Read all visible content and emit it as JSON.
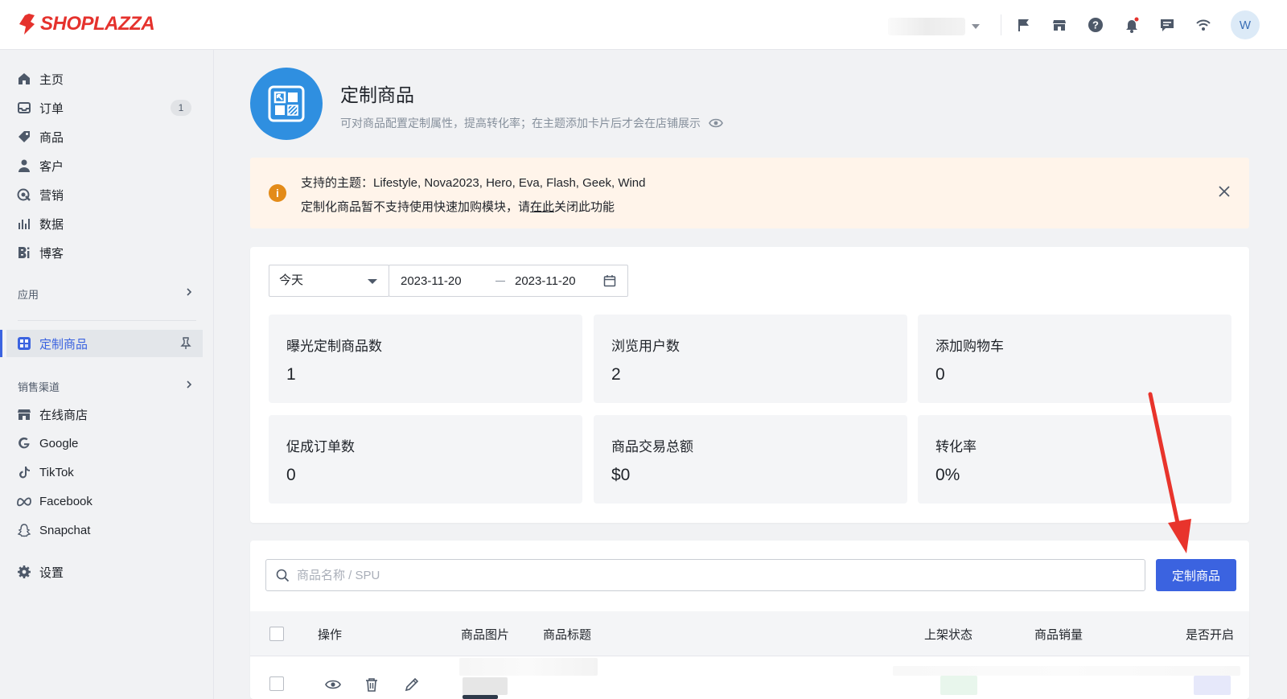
{
  "brand": {
    "name": "SHOPLAZZA",
    "color": "#e5322d"
  },
  "topbar": {
    "icons": [
      "flag-icon",
      "store-icon",
      "help-icon",
      "bell-icon",
      "message-icon",
      "wifi-icon"
    ],
    "avatar_initial": "W"
  },
  "sidebar": {
    "items": [
      {
        "label": "主页",
        "icon": "home-icon"
      },
      {
        "label": "订单",
        "icon": "inbox-icon",
        "badge": "1"
      },
      {
        "label": "商品",
        "icon": "tag-icon"
      },
      {
        "label": "客户",
        "icon": "person-icon"
      },
      {
        "label": "营销",
        "icon": "marketing-icon"
      },
      {
        "label": "数据",
        "icon": "bar-chart-icon"
      },
      {
        "label": "博客",
        "icon": "blog-icon"
      }
    ],
    "apps_label": "应用",
    "active_app": "定制商品",
    "channels_label": "销售渠道",
    "channels": [
      {
        "label": "在线商店",
        "icon": "store-icon"
      },
      {
        "label": "Google",
        "icon": "google-icon"
      },
      {
        "label": "TikTok",
        "icon": "tiktok-icon"
      },
      {
        "label": "Facebook",
        "icon": "meta-icon"
      },
      {
        "label": "Snapchat",
        "icon": "snapchat-icon"
      }
    ],
    "settings_label": "设置"
  },
  "header": {
    "title": "定制商品",
    "subtitle": "可对商品配置定制属性，提高转化率；在主题添加卡片后才会在店铺展示"
  },
  "alert": {
    "line1": "支持的主题：Lifestyle, Nova2023, Hero, Eva, Flash, Geek, Wind",
    "line2_pre": "定制化商品暂不支持使用快速加购模块，请",
    "line2_link": "在此",
    "line2_post": "关闭此功能"
  },
  "filters": {
    "range": "今天",
    "start_date": "2023-11-20",
    "end_date": "2023-11-20"
  },
  "stats": [
    {
      "label": "曝光定制商品数",
      "value": "1"
    },
    {
      "label": "浏览用户数",
      "value": "2"
    },
    {
      "label": "添加购物车",
      "value": "0"
    },
    {
      "label": "促成订单数",
      "value": "0"
    },
    {
      "label": "商品交易总额",
      "value": "$0"
    },
    {
      "label": "转化率",
      "value": "0%"
    }
  ],
  "search": {
    "placeholder": "商品名称 / SPU",
    "value": ""
  },
  "add_button_label": "定制商品",
  "table": {
    "columns": [
      "操作",
      "商品图片",
      "商品标题",
      "上架状态",
      "商品销量",
      "是否开启"
    ]
  },
  "colors": {
    "primary": "#3b63e0",
    "hero": "#2f8fe0",
    "alert_bg": "#fff4ea",
    "annotation_arrow": "#e8342c"
  }
}
